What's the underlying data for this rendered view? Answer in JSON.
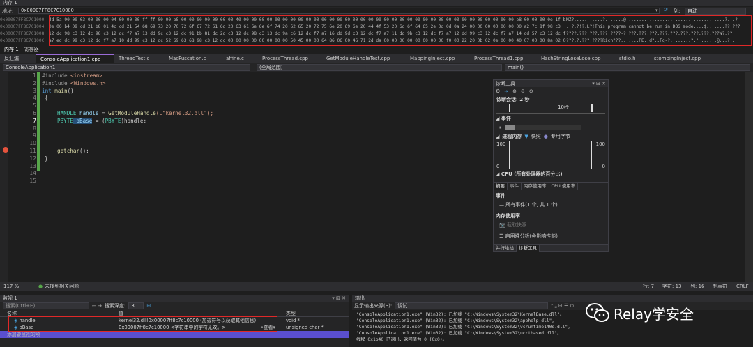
{
  "memory": {
    "title": "内存 1",
    "address_label": "地址:",
    "address_value": "0x00007FF8C7C10000",
    "column_label": "列:",
    "column_value": "自动",
    "rows": [
      {
        "addr": "0x00007FF8C7C1000",
        "hex": "4d 5a 90 00 03 00 00 00 04 00 00 00 ff ff 00 00 b8 00 00 00 00 00 00 00 40 00 00 00 00 00 00 00 00 00 00 00 00 00 00 00 00 00 00 00 00 00 00 00 00 00 00 00 00 00 00 00 00 00 00 00 e8 00 00 00 0e 1f ba",
        "ascii": "MZ?...........?.......@......................................?...?"
      },
      {
        "addr": "0x00007FF8C7C1004",
        "hex": "0e 00 b4 09 cd 21 b8 01 4c cd 21 54 68 69 73 20 70 72 6f 67 72 61 6d 20 63 61 6e 6e 6f 74 20 62 65 20 72 75 6e 20 69 6e 20 44 4f 53 20 6d 6f 64 65 2e 0d 0d 0a 24 00 00 00 00 00 00 00 a2 7c 8f 98 c3",
        "ascii": "..?.?!?.L?!This program cannot be run in DOS mode....$.......??|???"
      },
      {
        "addr": "0x00007FF8C7C1008",
        "hex": "12 dc 98 c3 12 dc 98 c3 12 dc f7 a7 13 dd 9c c3 12 dc 91 bb 81 dc 2d c3 12 dc 98 c3 13 dc 9a c6 12 dc f7 a7 16 dd 9d c3 12 dc f7 a7 11 dd 9b c3 12 dc f7 a7 12 dd 99 c3 12 dc f7 a7 14 dd 57 c3 12 dc f7",
        "ascii": "????.???.???.???.????-?.???.???.???.???.???.???.???.???.???W?.??"
      },
      {
        "addr": "0x00007FF8C7C100C",
        "hex": "a7 ed dc 99 c3 12 dc f7 a7 10 dd 99 c3 12 dc 52 69 63 68 98 c3 12 dc 00 00 00 00 00 00 00 00 50 45 00 00 64 86 06 00 46 71 2d da 00 00 00 00 00 00 00 00 f0 00 22 20 0b 02 0e 00 00 40 07 00 00 8a 02 00",
        "ascii": "???.?.???.????Rich???.......PE..d?..Fq-?........?.\" ......@...?.."
      }
    ],
    "subtabs": [
      "内存 1",
      "寄存器"
    ]
  },
  "editor": {
    "tabs": [
      "ConsoleApplication1.cpp",
      "ThreadTest.c",
      "MacFuscation.c",
      "affine.c",
      "ProcessThread.cpp",
      "GetModuleHandleTest.cpp",
      "MappingInject.cpp",
      "ProcessThread1.cpp",
      "HashStringLoseLose.cpp",
      "stdio.h",
      "stompingInject.cpp"
    ],
    "left_tab": "反汇编",
    "project_combo": "ConsoleApplication1",
    "scope_combo": "(全局范围)",
    "function_combo": "main()",
    "line_numbers": [
      "1",
      "2",
      "3",
      "4",
      "5",
      "6",
      "7",
      "8",
      "9",
      "10",
      "11",
      "12",
      "13",
      "14",
      "15"
    ]
  },
  "code": {
    "l1a": "#include ",
    "l1b": "<iostream>",
    "l2a": "#include ",
    "l2b": "<Windows.h>",
    "l3a": "int",
    "l3b": " main",
    "l3c": "()",
    "l4": "{",
    "l6a": "HANDLE",
    "l6b": " handle",
    "l6c": " = ",
    "l6d": "GetModuleHandle",
    "l6e": "(L\"kernel32.dll\");",
    "l7a": "PBYTE",
    "l7b": " pBase",
    "l7c": " = (",
    "l7d": "PBYTE",
    "l7e": ")handle;",
    "l11a": "getchar",
    "l11b": "();",
    "l12": "}"
  },
  "diag": {
    "title": "诊断工具",
    "session": "诊断会话: 2 秒",
    "timeline_label": "10秒",
    "events_header": "事件",
    "mem_header": "进程内存",
    "mem_legend1": "快照",
    "mem_legend2": "专用字节",
    "y_top": "100",
    "y_bottom": "0",
    "cpu_header": "CPU (所有处理器的百分比)",
    "cpu_top": "100",
    "tabs": [
      "摘要",
      "事件",
      "内存使用率",
      "CPU 使用率"
    ],
    "sec_events": "事件",
    "all_events": "所有事件(1 个, 共 1 个)",
    "sec_mem": "内存使用率",
    "snapshot_btn": "截取快照",
    "heap_btn": "启用堆分析(会影响性能)",
    "bottom_tabs": [
      "并行堆栈",
      "诊断工具"
    ]
  },
  "status": {
    "zoom": "117 %",
    "issues": "未找到相关问题",
    "line": "行: 7",
    "char": "字符: 13",
    "col": "列: 16",
    "tab": "制表符",
    "eol": "CRLF"
  },
  "watch": {
    "title": "监视 1",
    "search_placeholder": "搜索(Ctrl+E)",
    "depth_label": "搜索深度:",
    "depth_value": "3",
    "col_name": "名称",
    "col_value": "值",
    "col_type": "类型",
    "rows": [
      {
        "name": "handle",
        "value": "kernel32.dll!0x00007ff8c7c10000 (加载符号以获取其他信息)",
        "type": "void *"
      },
      {
        "name": "pBase",
        "value": "0x00007ff8c7c10000 <字符串中的字符无效。>",
        "type": "unsigned char *"
      }
    ],
    "add_hint": "添加要监视的项",
    "view_label": "查看"
  },
  "output": {
    "title": "输出",
    "source_label": "显示输出来源(S):",
    "source_value": "调试",
    "lines": [
      "\"ConsoleApplication1.exe\" (Win32): 已加载 \"C:\\Windows\\System32\\KernelBase.dll\"。",
      "\"ConsoleApplication1.exe\" (Win32): 已加载 \"C:\\Windows\\System32\\apphelp.dll\"。",
      "\"ConsoleApplication1.exe\" (Win32): 已加载 \"C:\\Windows\\System32\\vcruntime140d.dll\"。",
      "\"ConsoleApplication1.exe\" (Win32): 已加载 \"C:\\Windows\\System32\\ucrtbased.dll\"。",
      "线程 0x1b40 已退出，返回值为 0 (0x0)。"
    ]
  },
  "watermark": "Relay学安全",
  "colors": {
    "accent": "#9a6bd6",
    "highlight_box": "#e02828",
    "green_bar": "#57a64a",
    "watch_add_row": "#5a4fcf"
  }
}
